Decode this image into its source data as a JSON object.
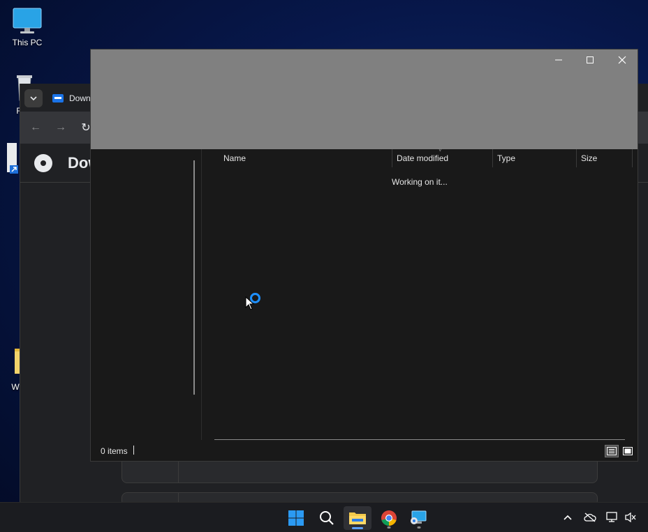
{
  "desktop": {
    "icons": [
      {
        "label": "This PC"
      },
      {
        "label": "Rec"
      },
      {
        "label": "W"
      }
    ]
  },
  "chrome": {
    "tab_title": "Down",
    "page_title": "Dow"
  },
  "explorer": {
    "columns": [
      "Name",
      "Date modified",
      "Type",
      "Size"
    ],
    "working_text": "Working on it...",
    "items_count": "0 items"
  },
  "colors": {
    "accent": "#1e90ff",
    "titlebar_gray": "#808080",
    "explorer_bg": "#191919"
  }
}
